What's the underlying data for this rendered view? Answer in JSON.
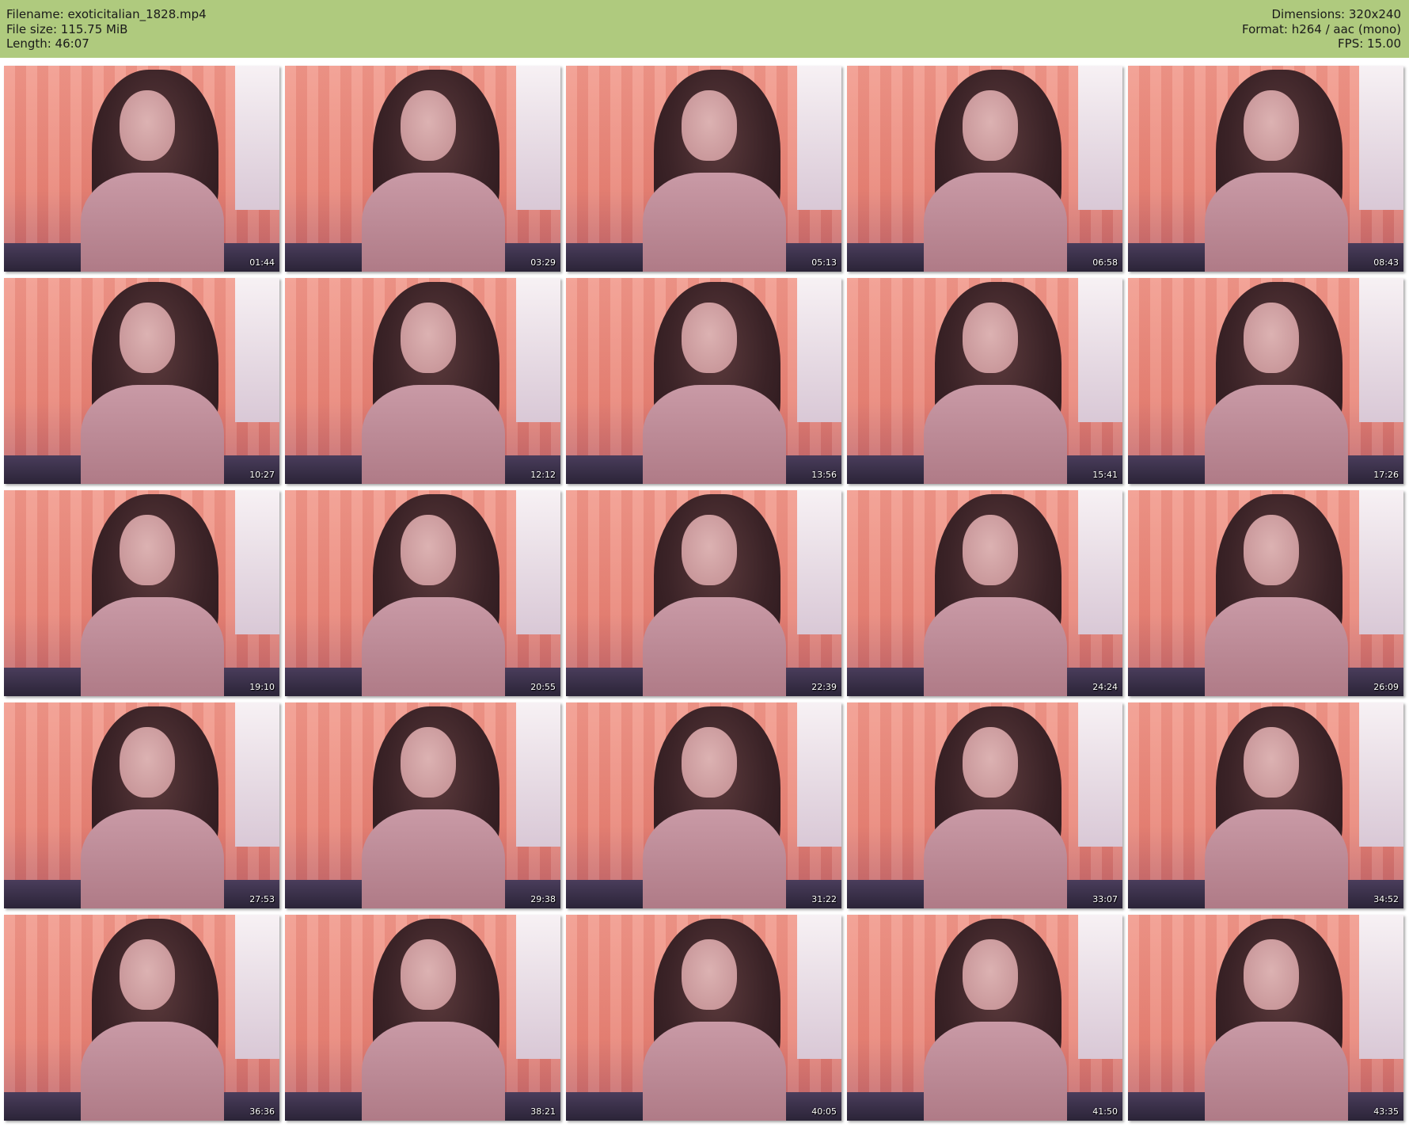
{
  "header": {
    "filename_line": "Filename: exoticitalian_1828.mp4",
    "filesize_line": "File size: 115.75 MiB",
    "length_line": "Length: 46:07",
    "dimensions_line": "Dimensions: 320x240",
    "format_line": "Format: h264 / aac (mono)",
    "fps_line": "FPS: 15.00",
    "background_color": "#afca7e"
  },
  "thumbnails": [
    {
      "timestamp": "01:44"
    },
    {
      "timestamp": "03:29"
    },
    {
      "timestamp": "05:13"
    },
    {
      "timestamp": "06:58"
    },
    {
      "timestamp": "08:43"
    },
    {
      "timestamp": "10:27"
    },
    {
      "timestamp": "12:12"
    },
    {
      "timestamp": "13:56"
    },
    {
      "timestamp": "15:41"
    },
    {
      "timestamp": "17:26"
    },
    {
      "timestamp": "19:10"
    },
    {
      "timestamp": "20:55"
    },
    {
      "timestamp": "22:39"
    },
    {
      "timestamp": "24:24"
    },
    {
      "timestamp": "26:09"
    },
    {
      "timestamp": "27:53"
    },
    {
      "timestamp": "29:38"
    },
    {
      "timestamp": "31:22"
    },
    {
      "timestamp": "33:07"
    },
    {
      "timestamp": "34:52"
    },
    {
      "timestamp": "36:36"
    },
    {
      "timestamp": "38:21"
    },
    {
      "timestamp": "40:05"
    },
    {
      "timestamp": "41:50"
    },
    {
      "timestamp": "43:35"
    }
  ]
}
